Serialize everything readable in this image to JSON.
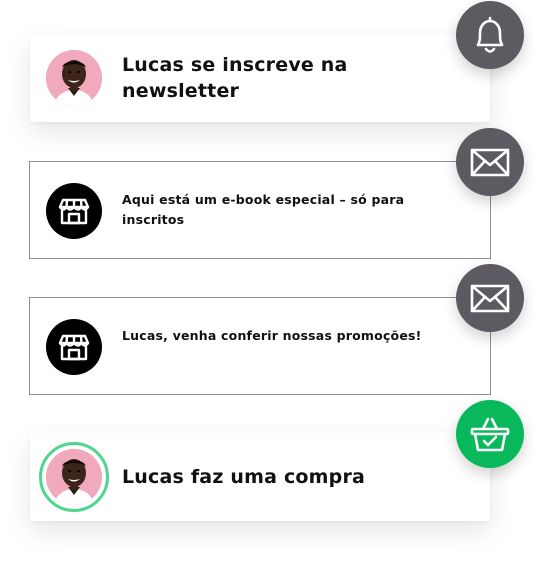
{
  "colors": {
    "bubble_grey": "#5e5a61",
    "bubble_green": "#08b85b",
    "avatar_ring": "#4fd68e",
    "avatar_bg": "#f0a9bd"
  },
  "flow": {
    "steps": [
      {
        "text": "Lucas se inscreve na newsletter",
        "icon": "bell-icon",
        "visual": "avatar"
      },
      {
        "text": "Aqui está um e-book especial – só para inscritos",
        "icon": "mail-icon",
        "visual": "store-icon"
      },
      {
        "text": "Lucas, venha conferir nossas promoções!",
        "icon": "mail-icon",
        "visual": "store-icon"
      },
      {
        "text": "Lucas faz uma compra",
        "icon": "basket-check-icon",
        "visual": "avatar"
      }
    ]
  }
}
